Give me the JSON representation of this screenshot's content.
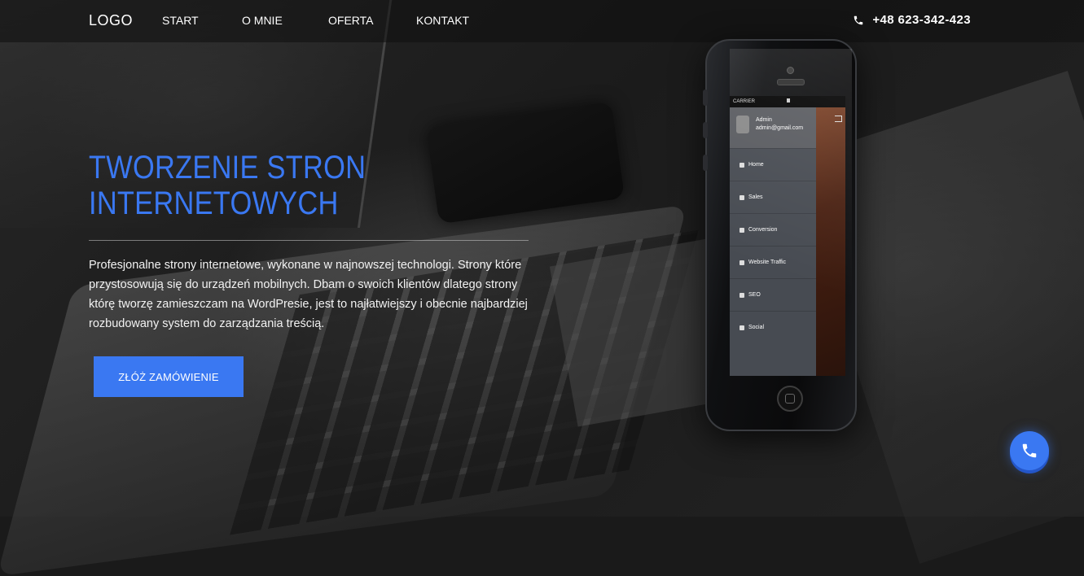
{
  "header": {
    "logo": "LOGO",
    "nav": [
      "START",
      "O MNIE",
      "OFERTA",
      "KONTAKT"
    ],
    "phone": "+48 623-342-423",
    "phone_icon": "phone-icon"
  },
  "hero": {
    "title_line1": "TWORZENIE STRON",
    "title_line2": "INTERNETOWYCH",
    "description": "Profesjonalne strony internetowe, wykonane w najnowszej technologi. Strony które przystosowują się do urządzeń mobilnych. Dbam o swoich klientów dlatego strony którę tworzę zamieszczam na WordPresie, jest to najłatwiejszy i obecnie najbardziej rozbudowany system do zarządzania treścią.",
    "cta_label": "ZŁÓŻ ZAMÓWIENIE"
  },
  "phone_mockup": {
    "carrier": "CARRIER",
    "user_name": "Admin",
    "user_email": "admin@gmail.com",
    "menu": [
      {
        "label": "Home",
        "icon": "home-icon"
      },
      {
        "label": "Sales",
        "icon": "money-icon"
      },
      {
        "label": "Conversion",
        "icon": "chart-icon"
      },
      {
        "label": "Website Traffic",
        "icon": "users-icon"
      },
      {
        "label": "SEO",
        "icon": "search-icon"
      },
      {
        "label": "Social",
        "icon": "share-icon"
      }
    ]
  },
  "floating_call": {
    "icon": "phone-icon"
  },
  "colors": {
    "accent": "#3a78f2",
    "background": "#1e1e1e",
    "text": "#ffffff"
  }
}
